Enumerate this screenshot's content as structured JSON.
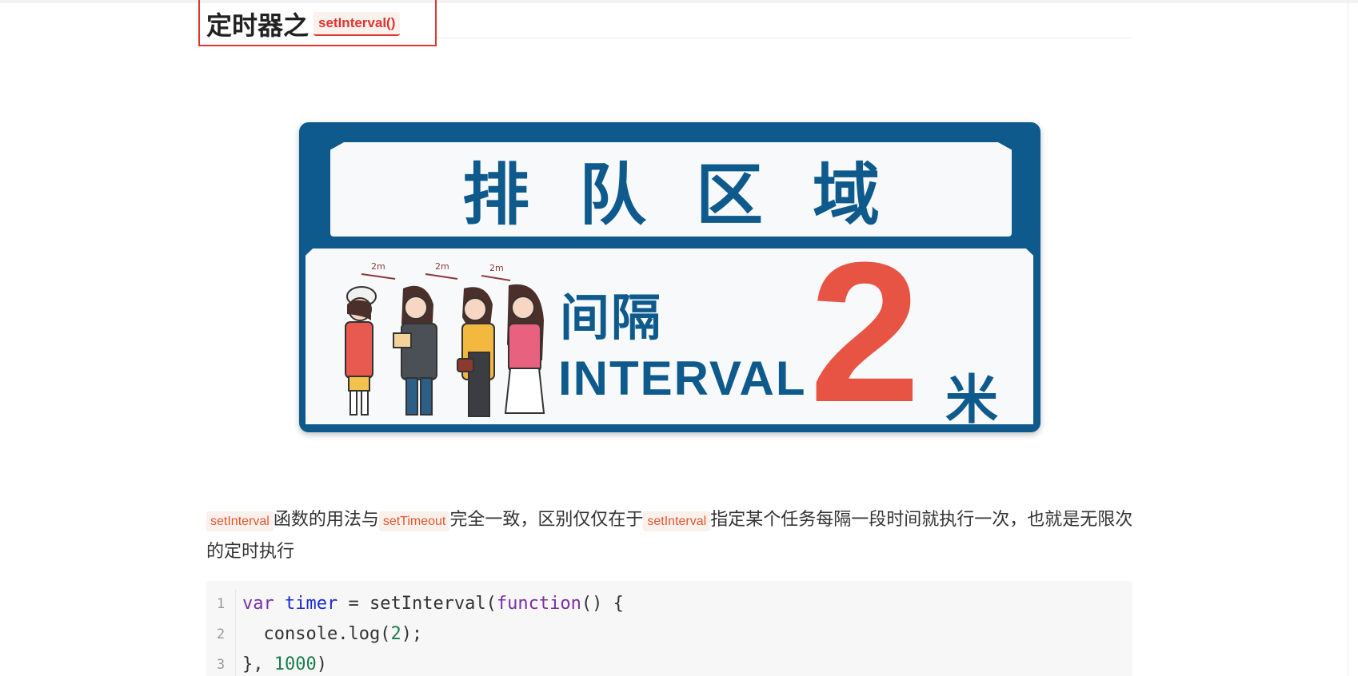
{
  "heading": {
    "text": "定时器之",
    "code": "setInterval()"
  },
  "banner": {
    "title": "排队区域",
    "cn_label": "间隔",
    "en_label": "INTERVAL",
    "number": "2",
    "unit": "米",
    "distance_marks": [
      "2m",
      "2m",
      "2m"
    ]
  },
  "paragraph": {
    "code1": "setInterval",
    "text1": "函数的用法与",
    "code2": "setTimeout",
    "text2": "完全一致，区别仅仅在于",
    "code3": "setInterval",
    "text3": "指定某个任务每隔一段时间就执行一次，也就是无限次的定时执行"
  },
  "code": {
    "line_numbers": [
      "1",
      "2",
      "3"
    ],
    "l1_kw": "var",
    "l1_var": " timer",
    "l1_rest": " = setInterval(",
    "l1_fn": "function",
    "l1_end": "() {",
    "l2_a": "  console.log(",
    "l2_num": "2",
    "l2_b": ");",
    "l3_a": "}, ",
    "l3_num": "1000",
    "l3_b": ")"
  },
  "colors": {
    "banner_blue": "#0e5a8c",
    "accent_red": "#e85444",
    "heading_border": "#e0342f"
  }
}
